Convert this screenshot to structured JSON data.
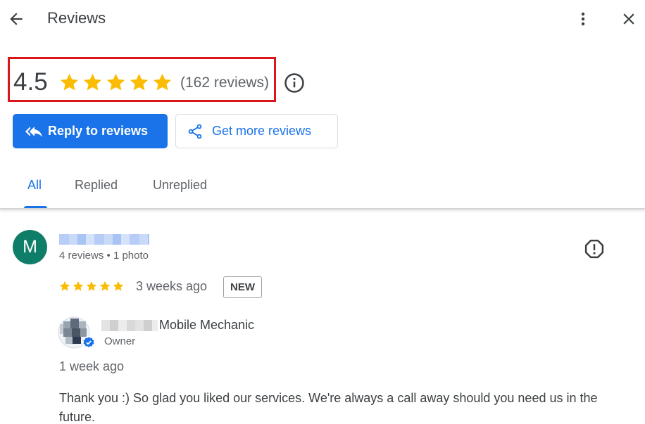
{
  "header": {
    "title": "Reviews",
    "back_icon": "arrow-left-icon",
    "more_icon": "more-vert-icon",
    "close_icon": "close-icon"
  },
  "summary": {
    "rating": "4.5",
    "stars_filled": 5,
    "review_count": "(162 reviews)",
    "info_icon": "info-icon"
  },
  "actions": {
    "reply_label": "Reply to reviews",
    "get_more_label": "Get more reviews"
  },
  "tabs": [
    {
      "label": "All",
      "active": true
    },
    {
      "label": "Replied",
      "active": false
    },
    {
      "label": "Unreplied",
      "active": false
    }
  ],
  "review": {
    "avatar_letter": "M",
    "reviewer_meta": "4 reviews • 1 photo",
    "stars": 5,
    "time": "3 weeks ago",
    "badge": "NEW",
    "reply": {
      "owner_name": "Mobile Mechanic",
      "role": "Owner",
      "time": "1 week ago",
      "text": "Thank you :) So glad you liked our services. We're always a call away should you need us in the future."
    }
  },
  "colors": {
    "accent": "#1a73e8",
    "star": "#fbbc04",
    "highlight_box": "#d9161b",
    "avatar_bg": "#0f7e68"
  }
}
